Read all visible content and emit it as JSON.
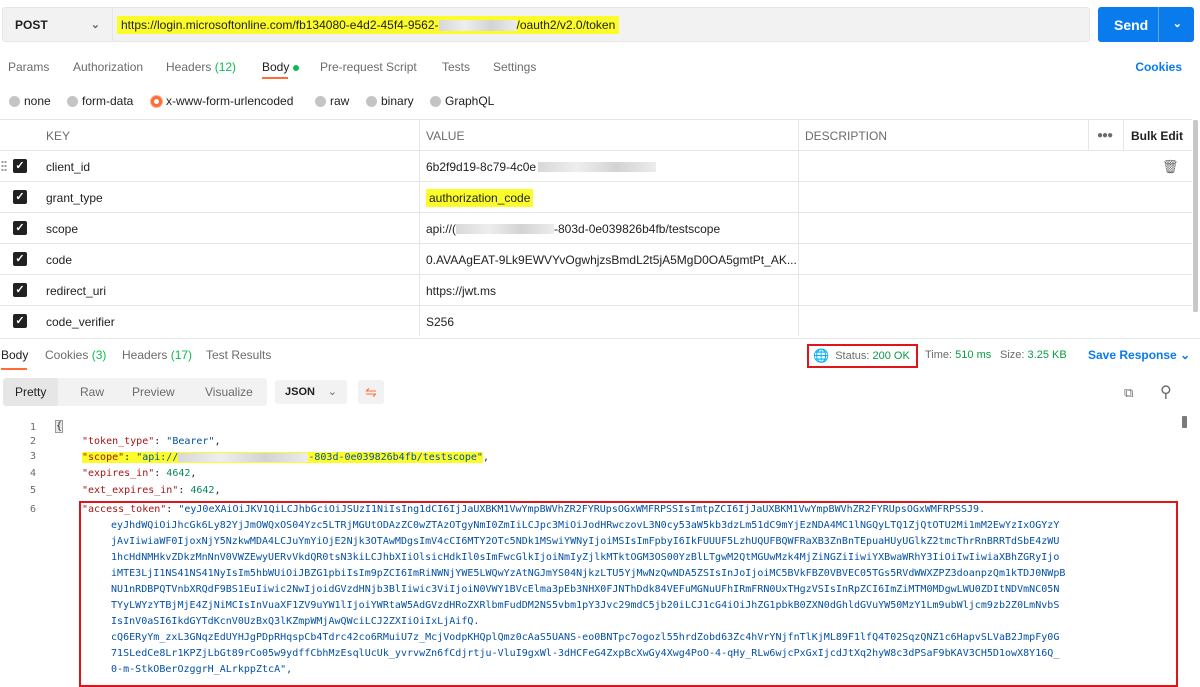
{
  "request": {
    "method": "POST",
    "url_start": "https://login.microsoftonline.com/fb134080-e4d2-45f4-9562-",
    "url_end": "/oauth2/v2.0/token",
    "send_label": "Send"
  },
  "request_tabs": {
    "params": "Params",
    "authorization": "Authorization",
    "headers": "Headers",
    "headers_count": "(12)",
    "body": "Body",
    "pre_request": "Pre-request Script",
    "tests": "Tests",
    "settings": "Settings",
    "cookies": "Cookies"
  },
  "body_types": {
    "none": "none",
    "form_data": "form-data",
    "urlencoded": "x-www-form-urlencoded",
    "raw": "raw",
    "binary": "binary",
    "graphql": "GraphQL",
    "selected": "x-www-form-urlencoded"
  },
  "table": {
    "headers": {
      "key": "KEY",
      "value": "VALUE",
      "description": "DESCRIPTION",
      "bulk_edit": "Bulk Edit"
    },
    "rows": [
      {
        "key": "client_id",
        "value": "6b2f9d19-8c79-4c0e",
        "value_suffix": ""
      },
      {
        "key": "grant_type",
        "value": "authorization_code",
        "value_suffix": ""
      },
      {
        "key": "scope",
        "value": "api://(",
        "value_suffix": "-803d-0e039826b4fb/testscope"
      },
      {
        "key": "code",
        "value": "0.AVAAgEAT-9Lk9EWVYvOgwhjzsBmdL2t5jA5MgD0OA5gmtPt_AK...",
        "value_suffix": ""
      },
      {
        "key": "redirect_uri",
        "value": "https://jwt.ms",
        "value_suffix": ""
      },
      {
        "key": "code_verifier",
        "value": "S256",
        "value_suffix": ""
      }
    ]
  },
  "response_tabs": {
    "body": "Body",
    "cookies": "Cookies",
    "cookies_count": "(3)",
    "headers": "Headers",
    "headers_count": "(17)",
    "test_results": "Test Results"
  },
  "response_meta": {
    "status_label": "Status:",
    "status_value": "200 OK",
    "time_label": "Time:",
    "time_value": "510 ms",
    "size_label": "Size:",
    "size_value": "3.25 KB",
    "save_response": "Save Response"
  },
  "viewer": {
    "pretty": "Pretty",
    "raw": "Raw",
    "preview": "Preview",
    "visualize": "Visualize",
    "format": "JSON"
  },
  "code": {
    "line_numbers": [
      "1",
      "2",
      "3",
      "4",
      "5",
      "6"
    ],
    "open_brace": "{",
    "token_type_key": "\"token_type\"",
    "token_type_value": "\"Bearer\"",
    "scope_key": "\"scope\"",
    "scope_value_start": "\"api://",
    "scope_value_end": "-803d-0e039826b4fb/testscope\"",
    "expires_in_key": "\"expires_in\"",
    "expires_in_value": "4642",
    "ext_expires_in_key": "\"ext_expires_in\"",
    "ext_expires_in_value": "4642",
    "access_token_key": "\"access_token\"",
    "access_token_first": "\"eyJ0eXAiOiJKV1QiLCJhbGciOiJSUzI1NiIsIng1dCI6IjJaUXBKM1VwYmpBWVhZR2FYRUpsOGxWMFRPSSIsImtpZCI6IjJaUXBKM1VwYmpBWVhZR2FYRUpsOGxWMFRPSSJ9.",
    "access_token_lines": [
      "eyJhdWQiOiJhcGk6Ly82YjJmOWQxOS04Yzc5LTRjMGUtODAzZC0wZTAzOTgyNmI0ZmIiLCJpc3MiOiJodHRwczovL3N0cy53aW5kb3dzLm51dC9mYjEzNDA4MC1lNGQyLTQ1ZjQtOTU2Mi1mM2EwYzIxOGYzY",
      "jAvIiwiaWF0IjoxNjY5NzkwMDA4LCJuYmYiOjE2Njk3OTAwMDgsImV4cCI6MTY2OTc5NDk1MSwiYWNyIjoiMSIsImFpbyI6IkFUUUF5LzhUQUFBQWFRaXB3ZnBnTEpuaHUyUGlkZ2tmcThrRnBRRTdSbE4zWU",
      "1hcHdNMHkvZDkzMnNnV0VWZEwyUERvVkdQR0tsN3kiLCJhbXIiOlsicHdkIl0sImFwcGlkIjoiNmIyZjlkMTktOGM3OS00YzBlLTgwM2QtMGUwMzk4MjZiNGZiIiwiYXBwaWRhY3IiOiIwIiwiaXBhZGRyIjo",
      "iMTE3LjI1NS41NS41NyIsIm5hbWUiOiJBZG1pbiIsIm9pZCI6ImRiNWNjYWE5LWQwYzAtNGJmYS04NjkzLTU5YjMwNzQwNDA5ZSIsInJoIjoiMC5BVkFBZ0VBVEC05TGs5RVdWWXZPZ3doanpzQm1kTDJ0NWpB",
      "NU1nRDBPQTVnbXRQdF9BS1EuIiwic2NwIjoidGVzdHNjb3BlIiwic3ViIjoiN0VWY1BVcElma3pEb3NHX0FJNThDdk84VEFuMGNuUFhIRmFRN0UxTHgzVSIsInRpZCI6ImZiMTM0MDgwLWU0ZDItNDVmNC05N",
      "TYyLWYzYTBjMjE4ZjNiMCIsInVuaXF1ZV9uYW1lIjoiYWRtaW5AdGVzdHRoZXRlbmFudDM2NS5vbm1pY3Jvc29mdC5jb20iLCJ1cG4iOiJhZG1pbkB0ZXN0dGhldGVuYW50MzY1Lm9ubWljcm9zb2Z0LmNvbS",
      "IsInV0aSI6IkdGYTdKcnV0UzBxQ3lKZmpWMjAwQWciLCJ2ZXIiOiIxLjAifQ.",
      "cQ6ERyYm_zxL3GNqzEdUYHJgPDpRHqspCb4Tdrc42co6RMuiU7z_McjVodpKHQplQmz0cAaS5UANS-eo0BNTpc7ogozl55hrdZobd63Zc4hVrYNjfnTlKjML89F1lfQ4T02SqzQNZ1c6HapvSLVaB2JmpFy0G",
      "71SLedCe8Lr1KPZjLbGt89rCo05w9ydffCbhMzEsqlUcUk_yvrvwZn6fCdjrtju-VluI9gxWl-3dHCFeG4ZxpBcXwGy4Xwg4PoO-4-qHy_RLw6wjcPxGxIjcdJtXq2hyW8c3dPSaF9bKAV3CH5D1owX8Y16Q_",
      "0-m-StkOBerOzggrH_ALrkppZtcA\","
    ]
  }
}
